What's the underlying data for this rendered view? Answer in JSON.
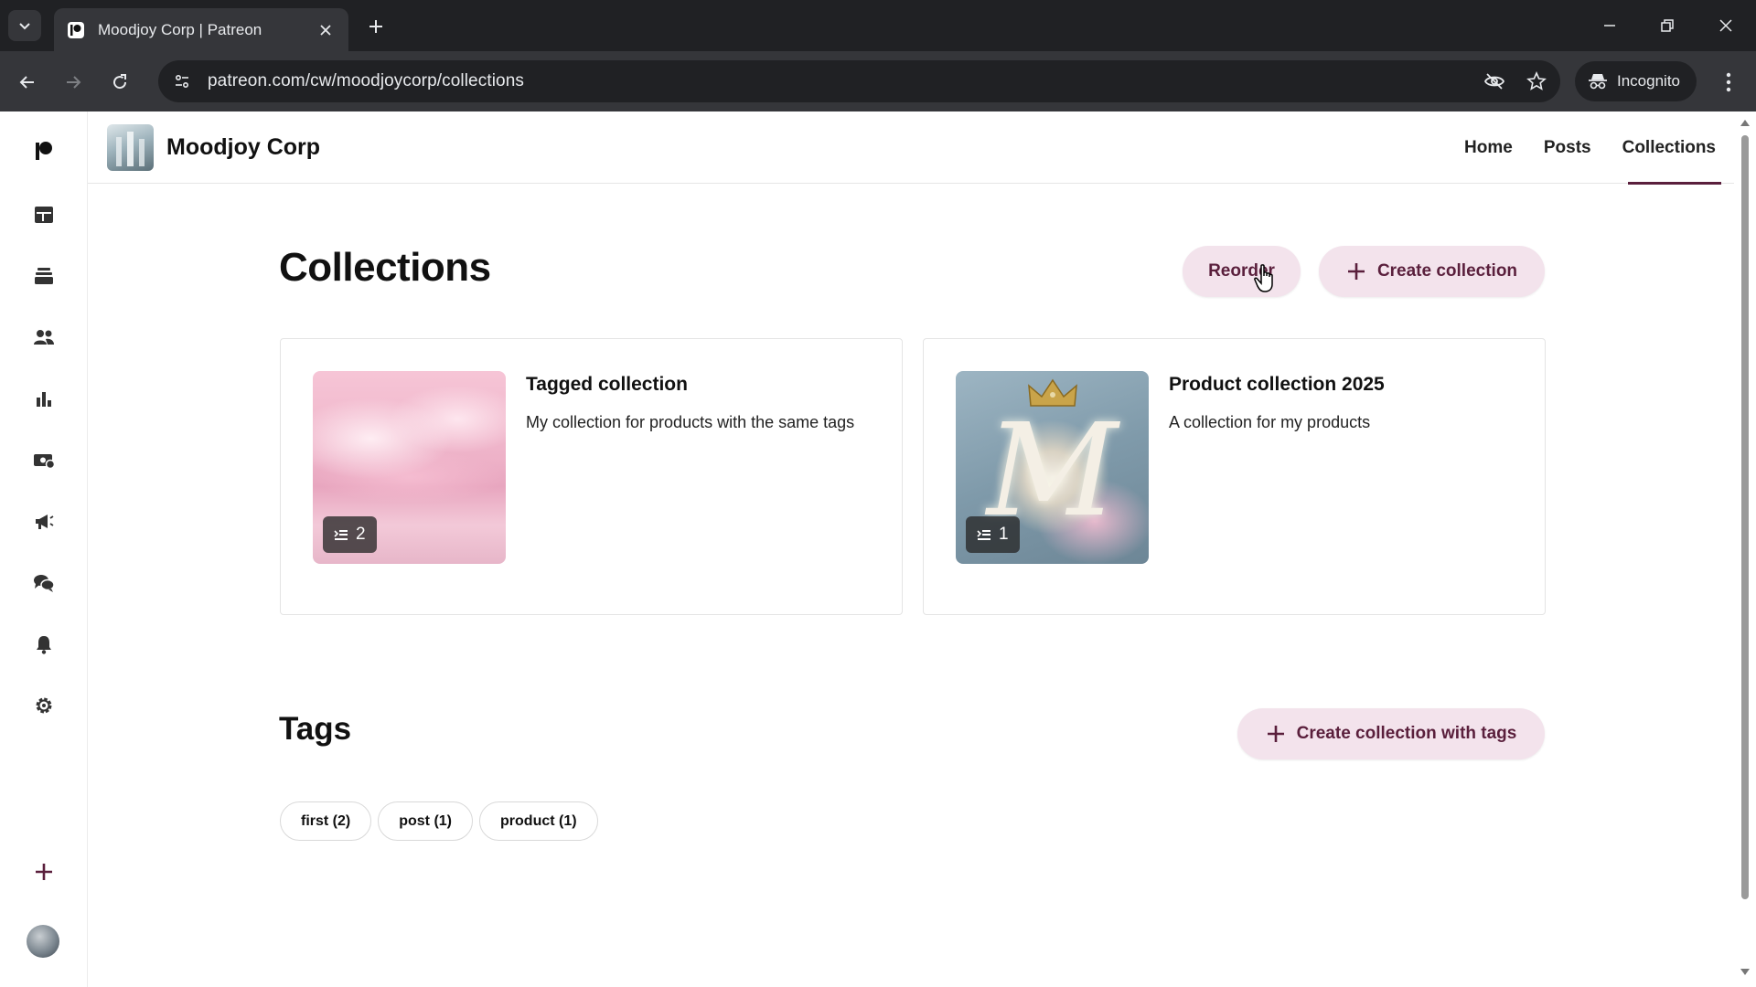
{
  "browser": {
    "tab_title": "Moodjoy Corp | Patreon",
    "url": "patreon.com/cw/moodjoycorp/collections",
    "incognito_label": "Incognito"
  },
  "sidebar": {
    "items": [
      {
        "icon": "patreon-logo-icon"
      },
      {
        "icon": "library-icon"
      },
      {
        "icon": "stack-icon"
      },
      {
        "icon": "audience-icon"
      },
      {
        "icon": "insights-icon"
      },
      {
        "icon": "payouts-icon"
      },
      {
        "icon": "promotions-icon"
      },
      {
        "icon": "chats-icon"
      },
      {
        "icon": "notifications-bell-icon"
      },
      {
        "icon": "settings-gear-icon"
      },
      {
        "icon": "create-plus-icon"
      }
    ]
  },
  "header": {
    "creator_name": "Moodjoy Corp",
    "nav": [
      "Home",
      "Posts",
      "Collections"
    ],
    "active_nav": "Collections"
  },
  "main": {
    "title": "Collections",
    "reorder_label": "Reorder",
    "create_label": "Create collection",
    "collections": [
      {
        "title": "Tagged collection",
        "description": "My collection for products with the same tags",
        "count": "2"
      },
      {
        "title": "Product collection 2025",
        "description": "A collection for my products",
        "count": "1"
      }
    ],
    "tags_title": "Tags",
    "create_with_tags_label": "Create collection with tags",
    "tags": [
      "first (2)",
      "post (1)",
      "product (1)"
    ]
  },
  "colors": {
    "accent": "#5a1f3c",
    "button_bg": "#f3e3ec",
    "chrome_dark": "#202124",
    "chrome_mid": "#35363a"
  }
}
